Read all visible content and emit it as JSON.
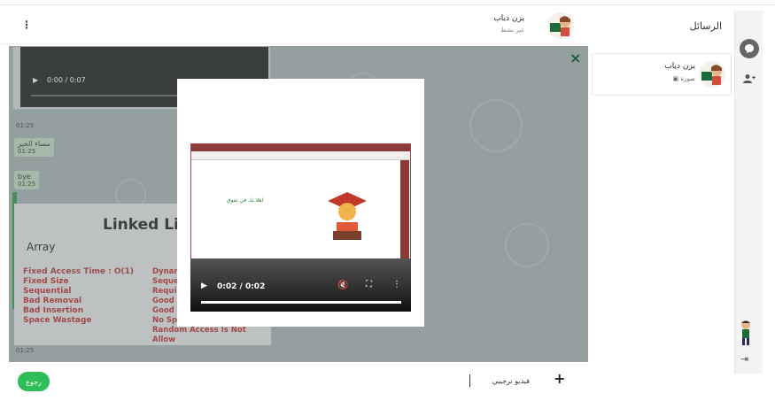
{
  "sidebar": {
    "title": "الرسائل",
    "conversations": [
      {
        "name": "يزن دياب",
        "preview": "صورة"
      }
    ]
  },
  "chat": {
    "contact_name": "يزن دياب",
    "contact_status": "غير نشط",
    "messages": [
      {
        "video_time": "0:00 / 0:07",
        "time": "01:25"
      },
      {
        "text": "مساء الخير",
        "time": "01:25"
      },
      {
        "text": "bye",
        "time": "01:25"
      }
    ],
    "slide": {
      "title": "Linked Li",
      "subtitle": "Array",
      "left_items": [
        "Fixed Access Time : O(1)",
        "Fixed Size",
        "Sequential",
        "Bad Removal",
        "Bad Insertion",
        "Space Wastage"
      ],
      "right_items": [
        "Dynam",
        "Sequer",
        "Require",
        "Good R",
        "Good In",
        "No Spa",
        "Random Access Is Not Allow"
      ],
      "time": "01:25"
    }
  },
  "viewer": {
    "close_icon": "×",
    "video_time": "0:02 / 0:02",
    "inner_heading": "اهلا بك في تفوق"
  },
  "footer": {
    "back_label": "رجوع",
    "caption_value": "فيديو ترجيبي",
    "plus": "+"
  },
  "rail": {
    "chat_icon": "chat-bubble-icon",
    "contacts_icon": "add-user-icon",
    "logout_icon": "logout-icon"
  },
  "colors": {
    "accent": "#2ebd59",
    "close": "#1c5c3a"
  }
}
